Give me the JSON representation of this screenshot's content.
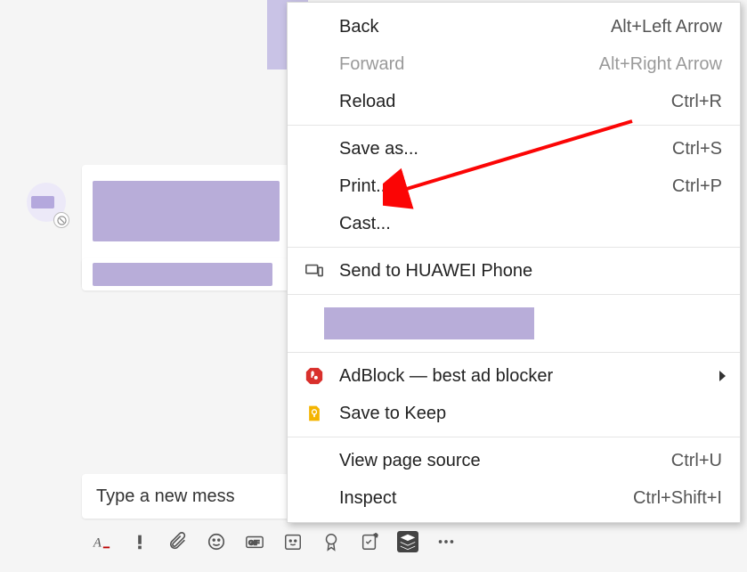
{
  "chat": {
    "compose_placeholder": "Type a new mess"
  },
  "toolbar": {
    "format": "Aᵨ",
    "priority": "!",
    "attach": "📎",
    "emoji": "☺",
    "gif": "GIF",
    "sticker": "Sticker",
    "award": "Award",
    "task": "Task",
    "stack": "Stack",
    "more": "⋯"
  },
  "context_menu": {
    "back": {
      "label": "Back",
      "shortcut": "Alt+Left Arrow"
    },
    "forward": {
      "label": "Forward",
      "shortcut": "Alt+Right Arrow"
    },
    "reload": {
      "label": "Reload",
      "shortcut": "Ctrl+R"
    },
    "save_as": {
      "label": "Save as...",
      "shortcut": "Ctrl+S"
    },
    "print": {
      "label": "Print...",
      "shortcut": "Ctrl+P"
    },
    "cast": {
      "label": "Cast..."
    },
    "send_to": {
      "label": "Send to HUAWEI Phone"
    },
    "adblock": {
      "label": "AdBlock — best ad blocker"
    },
    "save_to_keep": {
      "label": "Save to Keep"
    },
    "view_source": {
      "label": "View page source",
      "shortcut": "Ctrl+U"
    },
    "inspect": {
      "label": "Inspect",
      "shortcut": "Ctrl+Shift+I"
    }
  },
  "colors": {
    "redaction": "#b8add9",
    "arrow": "#fb0505"
  }
}
